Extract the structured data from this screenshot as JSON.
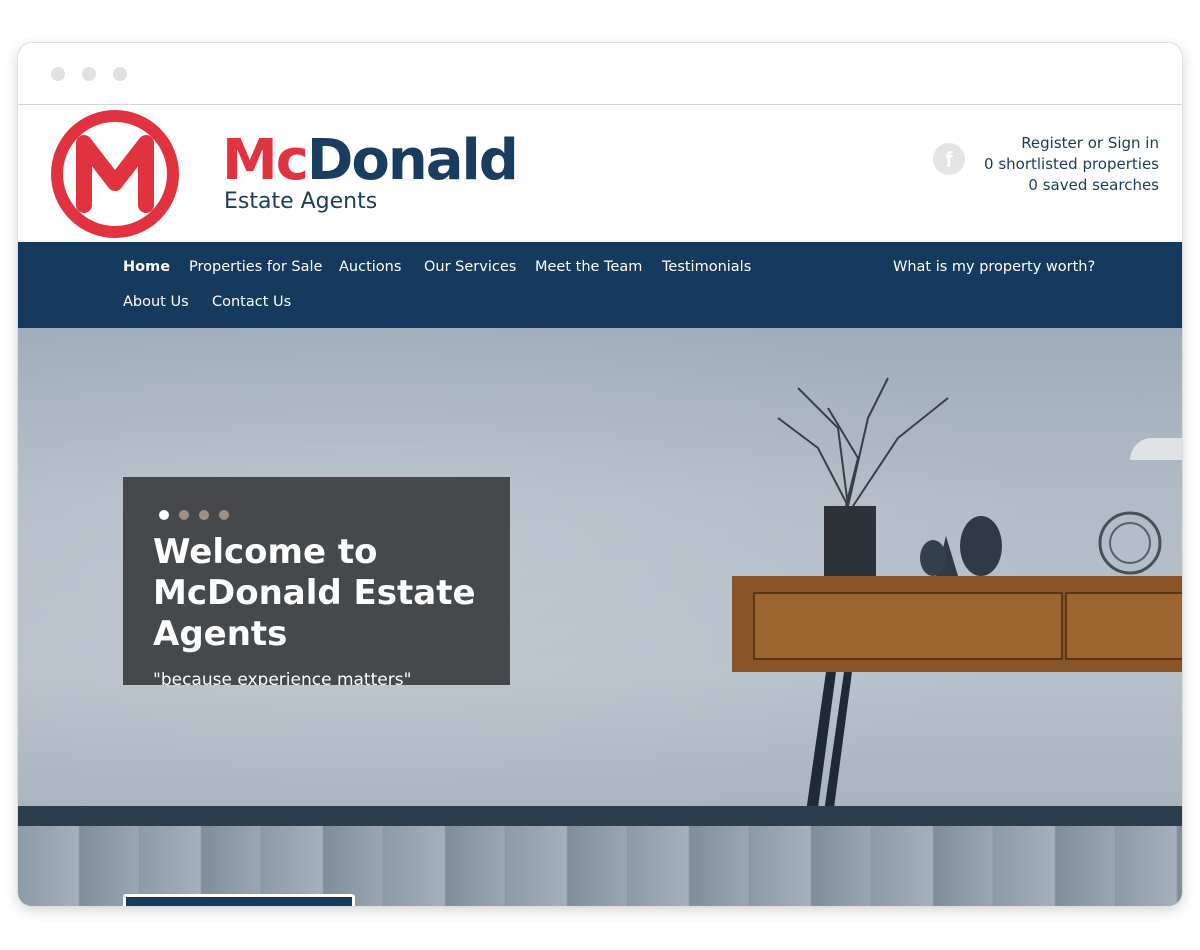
{
  "logo": {
    "mark": "M",
    "name_part1": "Mc",
    "name_part2": "Donald",
    "subtitle": "Estate Agents",
    "brand_red": "#e0323f",
    "brand_navy": "#1a3c5e"
  },
  "header": {
    "social_icon": "facebook-icon",
    "social_glyph": "f",
    "links": [
      "Register or Sign in",
      "0 shortlisted properties",
      "0 saved searches"
    ]
  },
  "nav": {
    "items": [
      "Home",
      "Properties for Sale",
      "Auctions",
      "Our Services",
      "Meet the Team",
      "Testimonials",
      "About Us",
      "Contact Us"
    ],
    "cta": "What is my property worth?",
    "background": "#153a5e"
  },
  "hero": {
    "title": "Welcome to McDonald Estate Agents",
    "tagline": "\"because experience matters\"",
    "slides_total": 4,
    "slide_active": 1
  }
}
